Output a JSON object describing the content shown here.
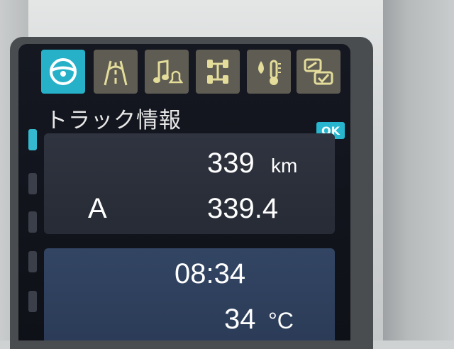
{
  "tabs": [
    {
      "icon": "steering-wheel-icon",
      "active": true
    },
    {
      "icon": "lane-road-icon",
      "active": false
    },
    {
      "icon": "music-bell-icon",
      "active": false
    },
    {
      "icon": "tire-pressure-icon",
      "active": false
    },
    {
      "icon": "fluid-temperature-icon",
      "active": false
    },
    {
      "icon": "settings-toggle-icon",
      "active": false
    }
  ],
  "header": {
    "title": "トラック情報"
  },
  "ok_label": "OK",
  "trip": {
    "distance_value": "339",
    "distance_unit": "km",
    "trip_label": "A",
    "trip_value": "339.4"
  },
  "status": {
    "time": "08:34",
    "temp_value": "34",
    "temp_unit": "°C"
  },
  "colors": {
    "accent": "#27b1c9",
    "tab_bg": "#5f5d53",
    "icon_color": "#e3dc9a"
  }
}
